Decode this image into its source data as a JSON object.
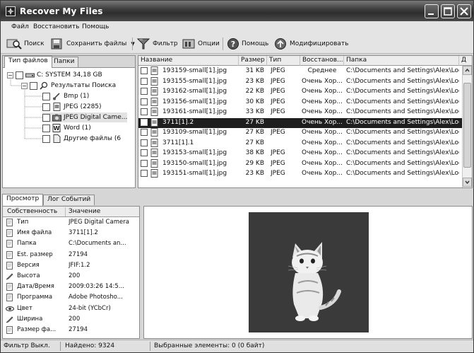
{
  "window": {
    "title": "Recover My Files"
  },
  "menu": [
    "Файл",
    "Восстановить",
    "Помощь"
  ],
  "toolbar": {
    "search": "Поиск",
    "save_files": "Сохранить файлы",
    "filter": "Фильтр",
    "options": "Опции",
    "help": "Помощь",
    "upgrade": "Модифицировать"
  },
  "left_tabs": [
    "Тип файлов",
    "Папки"
  ],
  "tree": {
    "drive": "C: SYSTEM  34,18 GB",
    "results": "Результаты Поиска",
    "items": [
      {
        "label": "Bmp (1)",
        "icon": "brush-icon"
      },
      {
        "label": "JPEG (2285)",
        "icon": "image-file-icon"
      },
      {
        "label": "JPEG Digital Came...",
        "icon": "camera-file-icon"
      },
      {
        "label": "Word (1)",
        "icon": "word-document-icon"
      },
      {
        "label": "Другие файлы (6",
        "icon": "generic-file-icon"
      }
    ]
  },
  "file_list": {
    "columns": [
      "Название",
      "Размер",
      "Тип",
      "Восстанов...",
      "Папка",
      "Д"
    ],
    "rows": [
      {
        "name": "193159-small[1].jpg",
        "size": "31 KB",
        "type": "JPEG",
        "recovery": "Среднее",
        "folder": "C:\\Documents and Settings\\Alex\\Loc..."
      },
      {
        "name": "193155-small[1].jpg",
        "size": "23 KB",
        "type": "JPEG",
        "recovery": "Очень Хор...",
        "folder": "C:\\Documents and Settings\\Alex\\Loc..."
      },
      {
        "name": "193162-small[1].jpg",
        "size": "22 KB",
        "type": "JPEG",
        "recovery": "Очень Хор...",
        "folder": "C:\\Documents and Settings\\Alex\\Loc..."
      },
      {
        "name": "193156-small[1].jpg",
        "size": "30 KB",
        "type": "JPEG",
        "recovery": "Очень Хор...",
        "folder": "C:\\Documents and Settings\\Alex\\Loc..."
      },
      {
        "name": "193161-small[1].jpg",
        "size": "33 KB",
        "type": "JPEG",
        "recovery": "Очень Хор...",
        "folder": "C:\\Documents and Settings\\Alex\\Loc..."
      },
      {
        "name": "3711[1].2",
        "size": "27 KB",
        "type": "",
        "recovery": "Очень Хор...",
        "folder": "C:\\Documents and Settings\\Alex\\Loc..."
      },
      {
        "name": "193109-small[1].jpg",
        "size": "27 KB",
        "type": "JPEG",
        "recovery": "Очень Хор...",
        "folder": "C:\\Documents and Settings\\Alex\\Loc..."
      },
      {
        "name": "3711[1].1",
        "size": "27 KB",
        "type": "",
        "recovery": "Очень Хор...",
        "folder": "C:\\Documents and Settings\\Alex\\Loc..."
      },
      {
        "name": "193153-small[1].jpg",
        "size": "38 KB",
        "type": "JPEG",
        "recovery": "Очень Хор...",
        "folder": "C:\\Documents and Settings\\Alex\\Loc..."
      },
      {
        "name": "193150-small[1].jpg",
        "size": "29 KB",
        "type": "JPEG",
        "recovery": "Очень Хор...",
        "folder": "C:\\Documents and Settings\\Alex\\Loc..."
      },
      {
        "name": "193151-small[1].jpg",
        "size": "23 KB",
        "type": "JPEG",
        "recovery": "Очень Хор...",
        "folder": "C:\\Documents and Settings\\Alex\\Loc..."
      }
    ]
  },
  "bottom_tabs": [
    "Просмотр",
    "Лог Событий"
  ],
  "properties": {
    "columns": [
      "Собственность",
      "Значение"
    ],
    "rows": [
      {
        "name": "Тип",
        "value": "JPEG Digital Camera",
        "icon": "doc-icon"
      },
      {
        "name": "Имя файла",
        "value": "3711[1].2",
        "icon": "doc-icon"
      },
      {
        "name": "Папка",
        "value": "C:\\Documents an...",
        "icon": "doc-icon"
      },
      {
        "name": "Est. размер",
        "value": "27194",
        "icon": "doc-icon"
      },
      {
        "name": "Версия",
        "value": "JFIF:1.2",
        "icon": "doc-icon"
      },
      {
        "name": "Высота",
        "value": "200",
        "icon": "pencil-icon"
      },
      {
        "name": "Дата/Время",
        "value": "2009:03:26 14:5...",
        "icon": "doc-icon"
      },
      {
        "name": "Программа",
        "value": "Adobe Photosho...",
        "icon": "doc-icon"
      },
      {
        "name": "Цвет",
        "value": "24-bit (YCbCr)",
        "icon": "eye-icon"
      },
      {
        "name": "Ширина",
        "value": "200",
        "icon": "pencil-icon"
      },
      {
        "name": "Размер фа...",
        "value": "27194",
        "icon": "doc-icon"
      }
    ]
  },
  "status": {
    "filter": "Фильтр Выкл.",
    "found": "Найдено: 9324",
    "selected": "Выбранные элементы: 0 (0 байт)"
  }
}
